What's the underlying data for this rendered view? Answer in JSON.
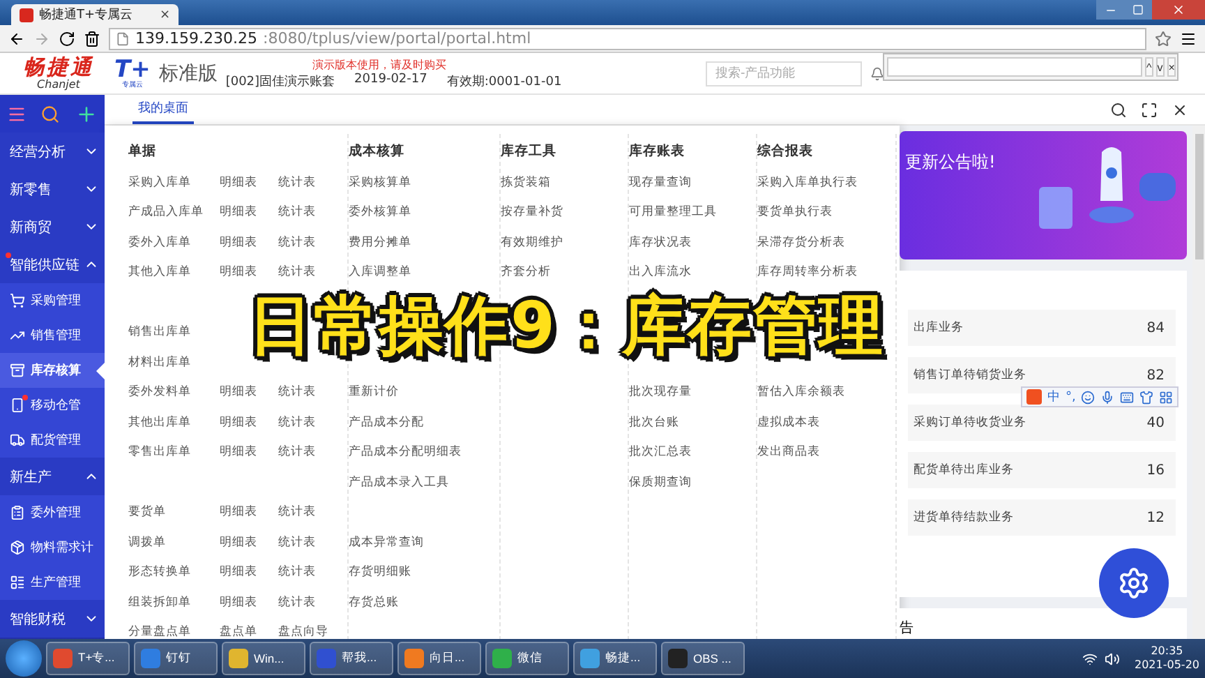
{
  "browser": {
    "tab_title": "畅捷通T+专属云",
    "tab_close": "×",
    "url_host": "139.159.230.25",
    "url_path": ":8080/tplus/view/portal/portal.html"
  },
  "find_bar": {
    "up": "^",
    "down": "v",
    "close": "×"
  },
  "header": {
    "logo_cn": "畅捷通",
    "logo_en": "Chanjet",
    "product": "T+",
    "product_sub": "专属云",
    "edition": "标准版",
    "notice": "演示版本使用，请及时购买",
    "account": "[002]固佳演示账套",
    "date": "2019-02-17",
    "validity": "有效期:0001-01-01",
    "search_placeholder": "搜索-产品功能"
  },
  "tabs": [
    {
      "label": "我的桌面",
      "selected": true
    }
  ],
  "sidebar": [
    {
      "kind": "group",
      "label": "经营分析",
      "expanded": false,
      "badge": false
    },
    {
      "kind": "group",
      "label": "新零售",
      "expanded": false,
      "badge": false
    },
    {
      "kind": "group",
      "label": "新商贸",
      "expanded": false,
      "badge": false
    },
    {
      "kind": "group",
      "label": "智能供应链",
      "expanded": true,
      "badge": true
    },
    {
      "kind": "sub",
      "label": "采购管理",
      "selected": false,
      "badge": false
    },
    {
      "kind": "sub",
      "label": "销售管理",
      "selected": false,
      "badge": false
    },
    {
      "kind": "sub",
      "label": "库存核算",
      "selected": true,
      "badge": false
    },
    {
      "kind": "sub",
      "label": "移动仓管",
      "selected": false,
      "badge": true
    },
    {
      "kind": "sub",
      "label": "配货管理",
      "selected": false,
      "badge": false
    },
    {
      "kind": "group",
      "label": "新生产",
      "expanded": true,
      "badge": false
    },
    {
      "kind": "sub",
      "label": "委外管理",
      "selected": false,
      "badge": false
    },
    {
      "kind": "sub",
      "label": "物料需求计",
      "selected": false,
      "badge": false
    },
    {
      "kind": "sub",
      "label": "生产管理",
      "selected": false,
      "badge": false
    },
    {
      "kind": "group",
      "label": "智能财税",
      "expanded": false,
      "badge": false
    }
  ],
  "menu": [
    {
      "title": "单据",
      "rows": [
        {
          "kind": "item",
          "cells": [
            "采购入库单",
            "明细表",
            "统计表"
          ]
        },
        {
          "kind": "item",
          "cells": [
            "产成品入库单",
            "明细表",
            "统计表"
          ]
        },
        {
          "kind": "item",
          "cells": [
            "委外入库单",
            "明细表",
            "统计表"
          ]
        },
        {
          "kind": "item",
          "cells": [
            "其他入库单",
            "明细表",
            "统计表"
          ]
        },
        {
          "kind": "spacer"
        },
        {
          "kind": "item",
          "cells": [
            "销售出库单"
          ]
        },
        {
          "kind": "item",
          "cells": [
            "材料出库单"
          ]
        },
        {
          "kind": "item",
          "cells": [
            "委外发料单",
            "明细表",
            "统计表"
          ]
        },
        {
          "kind": "item",
          "cells": [
            "其他出库单",
            "明细表",
            "统计表"
          ]
        },
        {
          "kind": "item",
          "cells": [
            "零售出库单",
            "明细表",
            "统计表"
          ]
        },
        {
          "kind": "spacer"
        },
        {
          "kind": "item",
          "cells": [
            "要货单",
            "明细表",
            "统计表"
          ]
        },
        {
          "kind": "item",
          "cells": [
            "调拨单",
            "明细表",
            "统计表"
          ]
        },
        {
          "kind": "item",
          "cells": [
            "形态转换单",
            "明细表",
            "统计表"
          ]
        },
        {
          "kind": "item",
          "cells": [
            "组装拆卸单",
            "明细表",
            "统计表"
          ]
        },
        {
          "kind": "item",
          "cells": [
            "分量盘点单",
            "盘点单",
            "盘点向导"
          ]
        }
      ]
    },
    {
      "title": "成本核算",
      "rows": [
        {
          "kind": "item",
          "cells": [
            "采购核算单"
          ]
        },
        {
          "kind": "item",
          "cells": [
            "委外核算单"
          ]
        },
        {
          "kind": "item",
          "cells": [
            "费用分摊单"
          ]
        },
        {
          "kind": "item",
          "cells": [
            "入库调整单"
          ]
        },
        {
          "kind": "spacer"
        },
        {
          "kind": "spacer"
        },
        {
          "kind": "spacer"
        },
        {
          "kind": "item",
          "cells": [
            "重新计价"
          ]
        },
        {
          "kind": "item",
          "cells": [
            "产品成本分配"
          ]
        },
        {
          "kind": "item",
          "cells": [
            "产品成本分配明细表"
          ]
        },
        {
          "kind": "item",
          "cells": [
            "产品成本录入工具"
          ]
        },
        {
          "kind": "spacer"
        },
        {
          "kind": "item",
          "cells": [
            "成本异常查询"
          ]
        },
        {
          "kind": "item",
          "cells": [
            "存货明细账"
          ]
        },
        {
          "kind": "item",
          "cells": [
            "存货总账"
          ]
        }
      ]
    },
    {
      "title": "库存工具",
      "rows": [
        {
          "kind": "item",
          "cells": [
            "拣货装箱"
          ]
        },
        {
          "kind": "item",
          "cells": [
            "按存量补货"
          ]
        },
        {
          "kind": "item",
          "cells": [
            "有效期维护"
          ]
        },
        {
          "kind": "item",
          "cells": [
            "齐套分析"
          ]
        }
      ]
    },
    {
      "title": "库存账表",
      "rows": [
        {
          "kind": "item",
          "cells": [
            "现存量查询"
          ]
        },
        {
          "kind": "item",
          "cells": [
            "可用量整理工具"
          ]
        },
        {
          "kind": "item",
          "cells": [
            "库存状况表"
          ]
        },
        {
          "kind": "item",
          "cells": [
            "出入库流水"
          ]
        },
        {
          "kind": "spacer"
        },
        {
          "kind": "spacer"
        },
        {
          "kind": "spacer"
        },
        {
          "kind": "item",
          "cells": [
            "批次现存量"
          ]
        },
        {
          "kind": "item",
          "cells": [
            "批次台账"
          ]
        },
        {
          "kind": "item",
          "cells": [
            "批次汇总表"
          ]
        },
        {
          "kind": "item",
          "cells": [
            "保质期查询"
          ]
        }
      ]
    },
    {
      "title": "综合报表",
      "rows": [
        {
          "kind": "item",
          "cells": [
            "采购入库单执行表"
          ]
        },
        {
          "kind": "item",
          "cells": [
            "要货单执行表"
          ]
        },
        {
          "kind": "item",
          "cells": [
            "呆滞存货分析表"
          ]
        },
        {
          "kind": "item",
          "cells": [
            "库存周转率分析表"
          ]
        },
        {
          "kind": "spacer"
        },
        {
          "kind": "spacer"
        },
        {
          "kind": "spacer"
        },
        {
          "kind": "item",
          "cells": [
            "暂估入库余额表"
          ]
        },
        {
          "kind": "item",
          "cells": [
            "虚拟成本表"
          ]
        },
        {
          "kind": "item",
          "cells": [
            "发出商品表"
          ]
        }
      ]
    }
  ],
  "banner": {
    "text": "更新公告啦!"
  },
  "tasks": [
    {
      "label": "出库业务",
      "count": "84"
    },
    {
      "label": "销售订单待销货业务",
      "count": "82"
    },
    {
      "label": "采购订单待收货业务",
      "count": "40"
    },
    {
      "label": "配货单待出库业务",
      "count": "16"
    },
    {
      "label": "进货单待结款业务",
      "count": "12"
    }
  ],
  "next_card_title": "告",
  "ime": {
    "mode": "中",
    "punct": "°,"
  },
  "video_title": "日常操作9：库存管理",
  "taskbar": {
    "apps": [
      {
        "label": "T+专...",
        "color": "#e04a2f"
      },
      {
        "label": "钉钉",
        "color": "#2f7de0"
      },
      {
        "label": "Win...",
        "color": "#e0b52f"
      },
      {
        "label": "帮我...",
        "color": "#3050d0"
      },
      {
        "label": "向日...",
        "color": "#f07a20"
      },
      {
        "label": "微信",
        "color": "#2fb04a"
      },
      {
        "label": "畅捷...",
        "color": "#40a0e0"
      },
      {
        "label": "OBS ...",
        "color": "#222222"
      }
    ],
    "time": "20:35",
    "date": "2021-05-20"
  }
}
